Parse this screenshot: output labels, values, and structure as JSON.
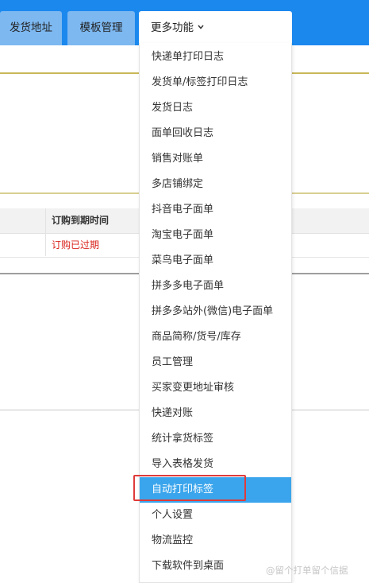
{
  "nav": {
    "tabs": [
      {
        "label": "发货地址"
      },
      {
        "label": "模板管理"
      }
    ],
    "more": {
      "label": "更多功能",
      "icon": "chevron-down-icon"
    }
  },
  "table": {
    "expire_header": "订购到期时间",
    "expire_value": "订购已过期"
  },
  "menu": {
    "items": [
      {
        "label": "快递单打印日志"
      },
      {
        "label": "发货单/标签打印日志"
      },
      {
        "label": "发货日志"
      },
      {
        "label": "面单回收日志"
      },
      {
        "label": "销售对账单"
      },
      {
        "label": "多店铺绑定"
      },
      {
        "label": "抖音电子面单"
      },
      {
        "label": "淘宝电子面单"
      },
      {
        "label": "菜鸟电子面单"
      },
      {
        "label": "拼多多电子面单"
      },
      {
        "label": "拼多多站外(微信)电子面单"
      },
      {
        "label": "商品简称/货号/库存"
      },
      {
        "label": "员工管理"
      },
      {
        "label": "买家变更地址审核"
      },
      {
        "label": "快递对账"
      },
      {
        "label": "统计拿货标签"
      },
      {
        "label": "导入表格发货"
      },
      {
        "label": "自动打印标签",
        "active": true
      },
      {
        "label": "个人设置"
      },
      {
        "label": "物流监控"
      },
      {
        "label": "下载软件到桌面"
      }
    ]
  },
  "watermark": "@留个打单留个信据",
  "colors": {
    "nav_bar": "#1b88ee",
    "tab_bg": "#7db8f1",
    "active_item": "#3aa5ec",
    "highlight_box": "#e03a3a",
    "expired_text": "#d9241c"
  }
}
